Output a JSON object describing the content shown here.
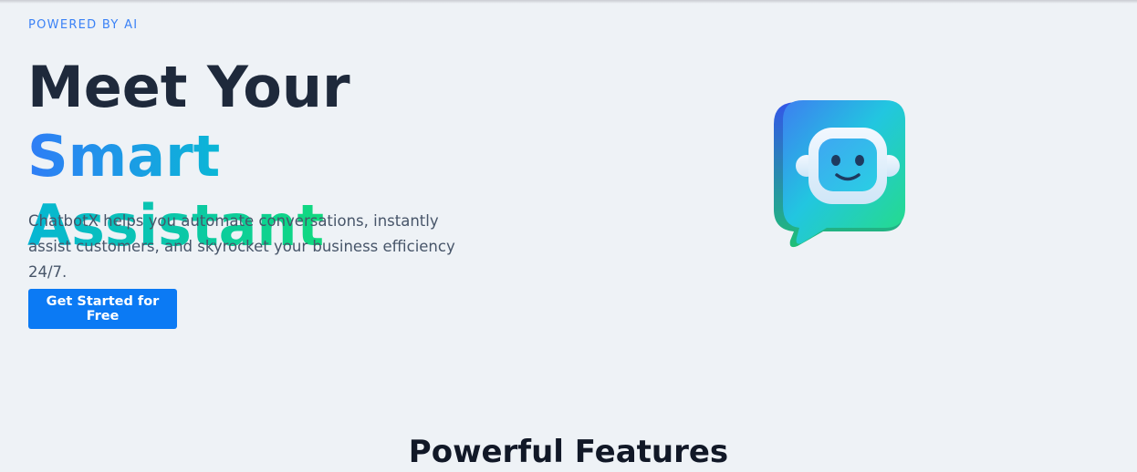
{
  "hero": {
    "eyebrow": "POWERED BY AI",
    "title_prefix": "Meet Your ",
    "title_highlight_1": "Smart",
    "title_highlight_2": "Assistant",
    "description": "ChatbotX helps you automate conversations, instantly assist customers, and skyrocket your business efficiency 24/7.",
    "cta_label": "Get Started for Free",
    "illustration_icon": "robot-chat-bubble-icon"
  },
  "features": {
    "title": "Powerful Features"
  },
  "colors": {
    "background": "#eef2f6",
    "heading": "#1e293b",
    "accent": "#3b82f6",
    "button": "#0b7af4",
    "gradient_blue": "#2f7df6",
    "gradient_cyan": "#06b6d4",
    "gradient_green": "#10d97e"
  }
}
